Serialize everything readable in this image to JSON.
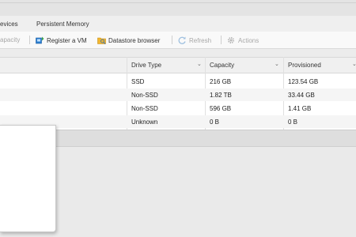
{
  "tabs": [
    "evices",
    "Persistent Memory"
  ],
  "toolbar": {
    "capacity_label": "apacity",
    "register_vm_label": "Register a VM",
    "datastore_browser_label": "Datastore browser",
    "refresh_label": "Refresh",
    "actions_label": "Actions"
  },
  "table": {
    "columns": [
      "Drive Type",
      "Capacity",
      "Provisioned"
    ],
    "rows": [
      {
        "drive_type": "SSD",
        "capacity": "216 GB",
        "provisioned": "123.54 GB"
      },
      {
        "drive_type": "Non-SSD",
        "capacity": "1.82 TB",
        "provisioned": "33.44 GB"
      },
      {
        "drive_type": "Non-SSD",
        "capacity": "596 GB",
        "provisioned": "1.41 GB"
      },
      {
        "drive_type": "Unknown",
        "capacity": "0 B",
        "provisioned": "0 B"
      }
    ]
  },
  "colors": {
    "accent": "#1a73c8",
    "disabled": "#a8a8a8"
  }
}
